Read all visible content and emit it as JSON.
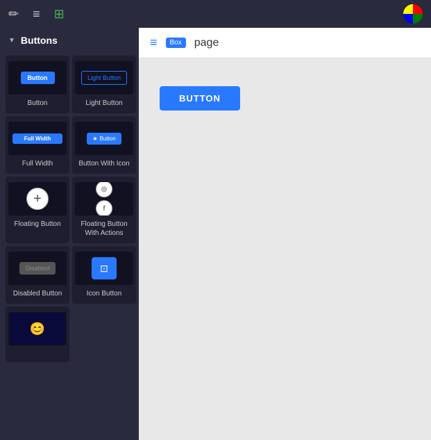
{
  "toolbar": {
    "icons": [
      "✏",
      "≡",
      "⊞"
    ],
    "active_index": 2
  },
  "sidebar": {
    "section_label": "Buttons",
    "components": [
      {
        "id": "button",
        "label": "Button",
        "preview_type": "blue-btn",
        "preview_text": "Button"
      },
      {
        "id": "light-button",
        "label": "Light Button",
        "preview_type": "light-btn",
        "preview_text": "Light Button"
      },
      {
        "id": "full-width",
        "label": "Full Width",
        "preview_type": "fullwidth-btn",
        "preview_text": "Full Width"
      },
      {
        "id": "button-with-icon",
        "label": "Button With Icon",
        "preview_type": "icon-btn-preview",
        "preview_text": "Button"
      },
      {
        "id": "floating-button",
        "label": "Floating Button",
        "preview_type": "floating-btn"
      },
      {
        "id": "floating-button-actions",
        "label": "Floating Button With Actions",
        "preview_type": "floating-actions-btn"
      },
      {
        "id": "disabled-button",
        "label": "Disabled Button",
        "preview_type": "disabled-btn",
        "preview_text": "Disabled"
      },
      {
        "id": "icon-button",
        "label": "Icon Button",
        "preview_type": "icon-button"
      },
      {
        "id": "custom-button",
        "label": "",
        "preview_type": "custom-face"
      }
    ]
  },
  "page": {
    "title": "page",
    "badge": "Box"
  },
  "canvas": {
    "button_label": "BUTTON"
  }
}
